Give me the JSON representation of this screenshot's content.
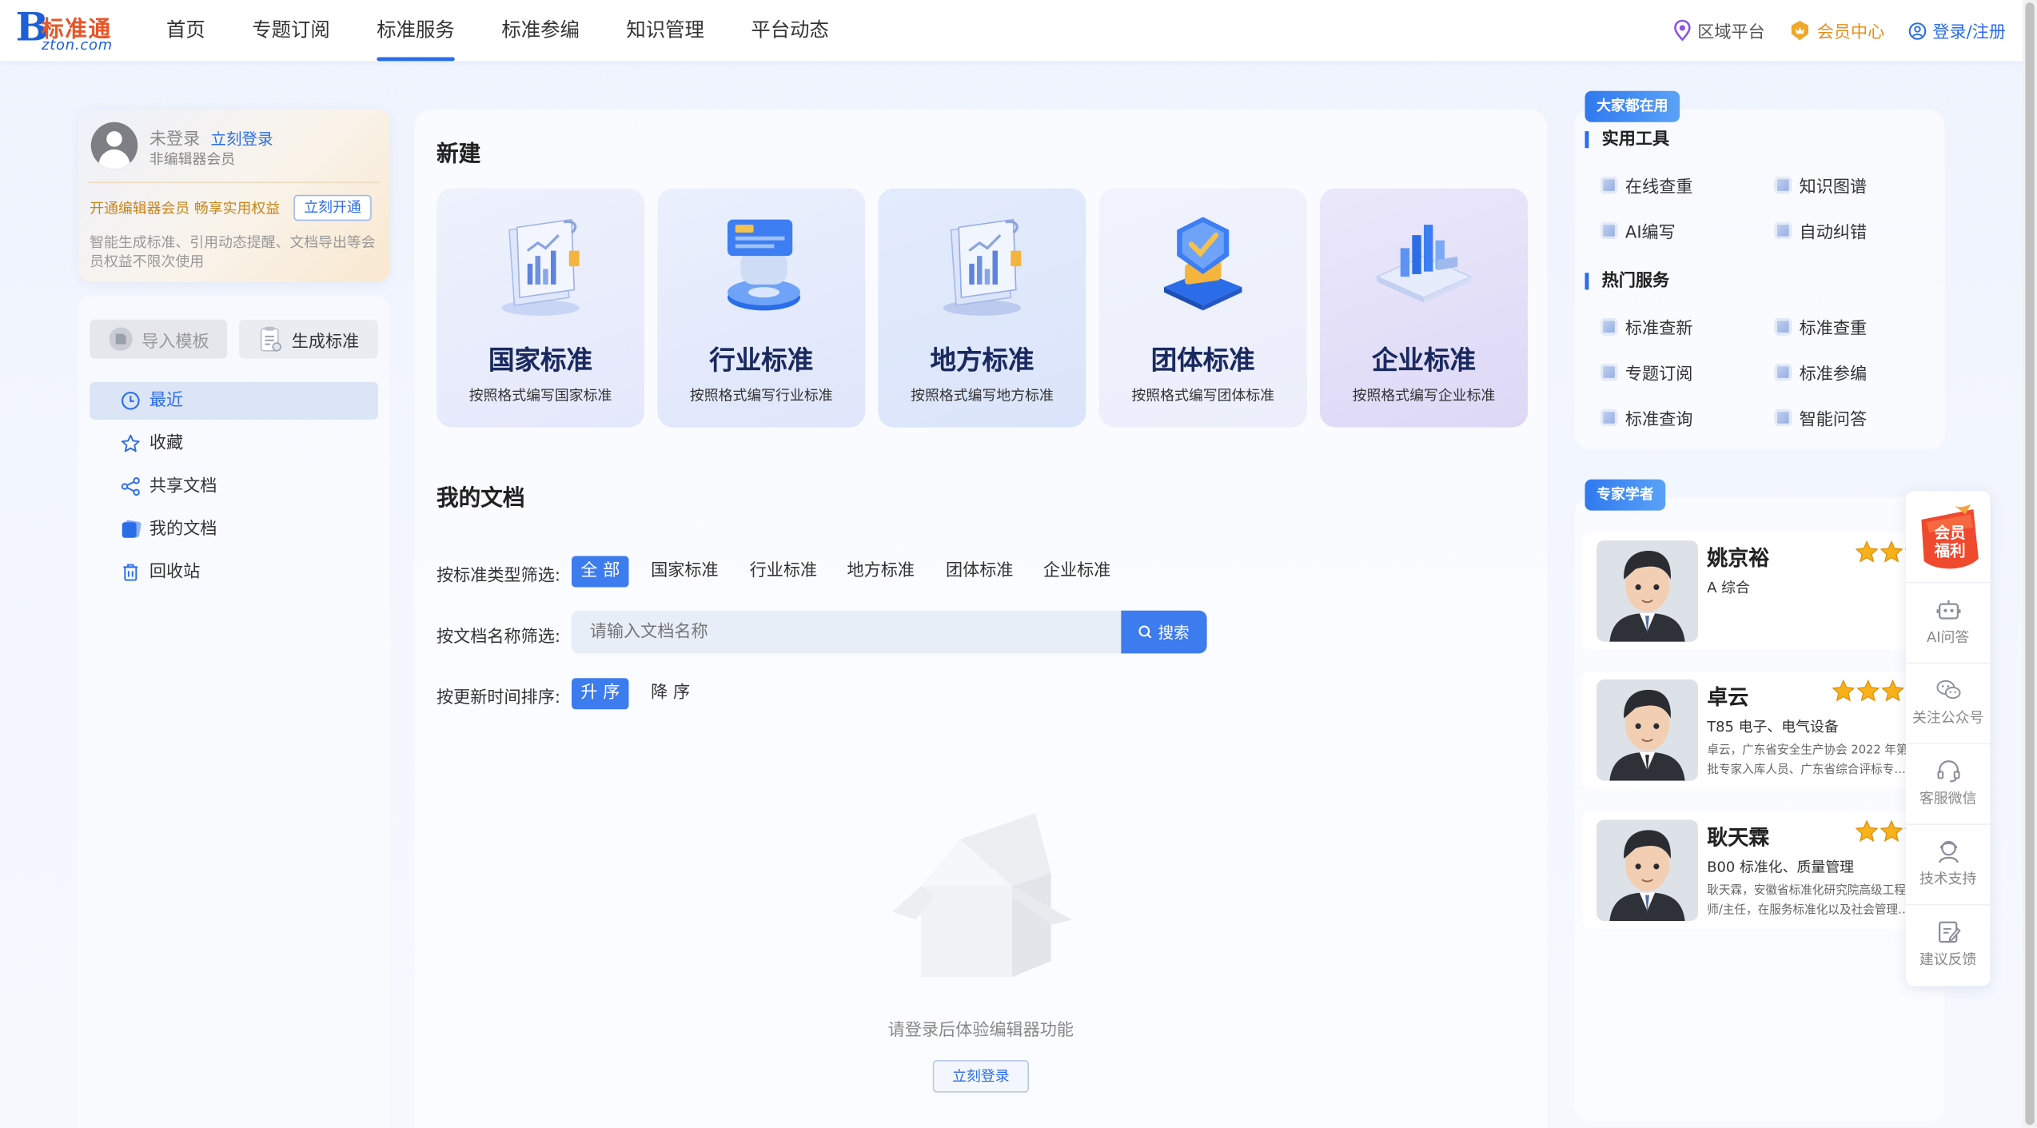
{
  "header": {
    "logo": {
      "letter": "B",
      "name": "标准通",
      "domain": "zton.com"
    },
    "nav": [
      {
        "label": "首页"
      },
      {
        "label": "专题订阅"
      },
      {
        "label": "标准服务"
      },
      {
        "label": "标准参编"
      },
      {
        "label": "知识管理"
      },
      {
        "label": "平台动态"
      }
    ],
    "active_nav": "标准服务",
    "right": {
      "region": "区域平台",
      "member": "会员中心",
      "login": "登录/注册"
    }
  },
  "user_card": {
    "status": "未登录",
    "login_link": "立刻登录",
    "subtitle": "非编辑器会员",
    "promo": "开通编辑器会员 畅享实用权益",
    "open_button": "立刻开通",
    "desc": "智能生成标准、引用动态提醒、文档导出等会员权益不限次使用"
  },
  "left_panel": {
    "import_button": "导入模板",
    "generate_button": "生成标准",
    "menu": [
      {
        "label": "最近",
        "icon": "clock-icon",
        "active": true
      },
      {
        "label": "收藏",
        "icon": "star-icon",
        "active": false
      },
      {
        "label": "共享文档",
        "icon": "share-icon",
        "active": false
      },
      {
        "label": "我的文档",
        "icon": "document-icon",
        "active": false
      },
      {
        "label": "回收站",
        "icon": "trash-icon",
        "active": false
      }
    ]
  },
  "create": {
    "title": "新建",
    "cards": [
      {
        "title": "国家标准",
        "subtitle": "按照格式编写国家标准"
      },
      {
        "title": "行业标准",
        "subtitle": "按照格式编写行业标准"
      },
      {
        "title": "地方标准",
        "subtitle": "按照格式编写地方标准"
      },
      {
        "title": "团体标准",
        "subtitle": "按照格式编写团体标准"
      },
      {
        "title": "企业标准",
        "subtitle": "按照格式编写企业标准"
      }
    ]
  },
  "my_docs": {
    "title": "我的文档",
    "type_filter_label": "按标准类型筛选:",
    "type_options": [
      "全 部",
      "国家标准",
      "行业标准",
      "地方标准",
      "团体标准",
      "企业标准"
    ],
    "type_selected": "全 部",
    "name_filter_label": "按文档名称筛选:",
    "search_placeholder": "请输入文档名称",
    "search_button": "搜索",
    "sort_label": "按更新时间排序:",
    "sort_options": [
      "升 序",
      "降 序"
    ],
    "sort_selected": "升 序",
    "empty_text": "请登录后体验编辑器功能",
    "empty_button": "立刻登录"
  },
  "tools": {
    "badge": "大家都在用",
    "utility_title": "实用工具",
    "utilities": [
      "在线查重",
      "知识图谱",
      "AI编写",
      "自动纠错"
    ],
    "hot_title": "热门服务",
    "hot": [
      "标准查新",
      "标准查重",
      "专题订阅",
      "标准参编",
      "标准查询",
      "智能问答"
    ]
  },
  "experts": {
    "badge": "专家学者",
    "list": [
      {
        "name": "姚京裕",
        "field": "A 综合",
        "desc_1": "",
        "desc_2": "",
        "stars": 3
      },
      {
        "name": "卓云",
        "field": "T85 电子、电气设备",
        "desc_1": "卓云，广东省安全生产协会 2022 年第",
        "desc_2": "批专家入库人员、广东省综合评标专…",
        "stars": 4
      },
      {
        "name": "耿天霖",
        "field": "B00 标准化、质量管理",
        "desc_1": "耿天霖，安徽省标准化研究院高级工程",
        "desc_2": "师/主任，在服务标准化以及社会管理…",
        "stars": 3
      }
    ]
  },
  "float_bar": {
    "vip_text_1": "会员",
    "vip_text_2": "福利",
    "items": [
      {
        "label": "AI问答",
        "icon": "robot-icon"
      },
      {
        "label": "关注公众号",
        "icon": "wechat-icon"
      },
      {
        "label": "客服微信",
        "icon": "headset-icon"
      },
      {
        "label": "技术支持",
        "icon": "support-icon"
      },
      {
        "label": "建议反馈",
        "icon": "feedback-icon"
      }
    ]
  },
  "colors": {
    "accent": "#2b6de8",
    "gold": "#e4901a",
    "card_title": "#1a2a60"
  }
}
